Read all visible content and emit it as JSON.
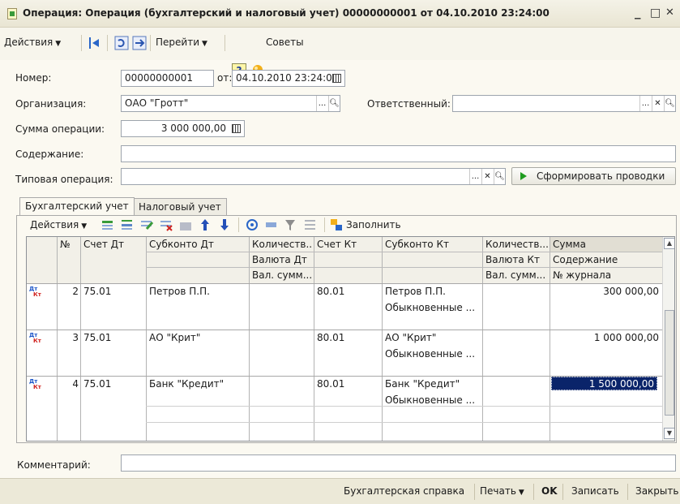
{
  "window": {
    "title": "Операция: Операция (бухгалтерский и налоговый учет) 00000000001 от 04.10.2010 23:24:00",
    "minimize": "_",
    "maximize": "□",
    "close": "✕"
  },
  "toolbar": {
    "actions": "Действия",
    "goto": "Перейти",
    "help": "?",
    "tips": "Советы"
  },
  "form": {
    "number_label": "Номер:",
    "number_value": "00000000001",
    "date_label": "от:",
    "date_value": "04.10.2010 23:24:00",
    "org_label": "Организация:",
    "org_value": "ОАО \"Гротт\"",
    "resp_label": "Ответственный:",
    "resp_value": "",
    "sum_label": "Сумма операции:",
    "sum_value": "3 000 000,00",
    "content_label": "Содержание:",
    "content_value": "",
    "typical_label": "Типовая операция:",
    "typical_value": "",
    "make_entries": "Сформировать проводки",
    "comment_label": "Комментарий:",
    "comment_value": ""
  },
  "tabs": [
    "Бухгалтерский учет",
    "Налоговый учет"
  ],
  "tab_toolbar": {
    "actions": "Действия",
    "fill": "Заполнить"
  },
  "grid": {
    "headers": {
      "num": "№",
      "acct_dt": "Счет Дт",
      "subconto_dt": "Субконто Дт",
      "qty_dt": "Количеств...",
      "currency_dt": "Валюта Дт",
      "cur_sum_dt": "Вал. сумм...",
      "acct_kt": "Счет Кт",
      "subconto_kt": "Субконто Кт",
      "qty_kt": "Количеств...",
      "currency_kt": "Валюта Кт",
      "cur_sum_kt": "Вал. сумм...",
      "sum": "Сумма",
      "content": "Содержание",
      "journal": "№ журнала"
    },
    "badge_dt": "Дт",
    "badge_kt": "Кт",
    "rows": [
      {
        "num": "2",
        "acct_dt": "75.01",
        "subconto_dt": "Петров П.П.",
        "acct_kt": "80.01",
        "subconto_kt": "Петров П.П.",
        "subconto_kt2": "Обыкновенные ...",
        "sum": "300 000,00"
      },
      {
        "num": "3",
        "acct_dt": "75.01",
        "subconto_dt": "АО \"Крит\"",
        "acct_kt": "80.01",
        "subconto_kt": "АО \"Крит\"",
        "subconto_kt2": "Обыкновенные ...",
        "sum": "1 000 000,00"
      },
      {
        "num": "4",
        "acct_dt": "75.01",
        "subconto_dt": "Банк \"Кредит\"",
        "acct_kt": "80.01",
        "subconto_kt": "Банк \"Кредит\"",
        "subconto_kt2": "Обыкновенные ...",
        "sum": "1 500 000,00"
      }
    ]
  },
  "footer": {
    "report": "Бухгалтерская справка",
    "print": "Печать",
    "ok": "OK",
    "save": "Записать",
    "close": "Закрыть"
  }
}
